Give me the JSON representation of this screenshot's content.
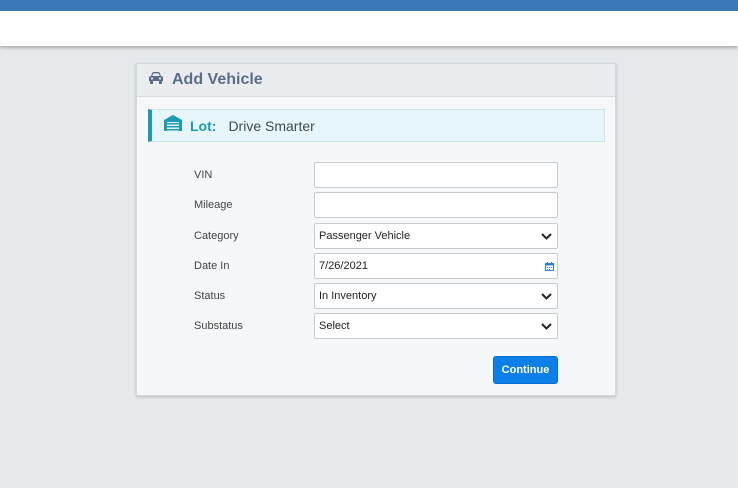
{
  "card": {
    "title": "Add Vehicle",
    "icon": "car-icon"
  },
  "lot": {
    "icon": "warehouse-icon",
    "label": "Lot:",
    "value": "Drive Smarter"
  },
  "form": {
    "vin_label": "VIN",
    "vin_value": "",
    "mileage_label": "Mileage",
    "mileage_value": "",
    "category_label": "Category",
    "category_value": "Passenger Vehicle",
    "date_in_label": "Date In",
    "date_in_value": "7/26/2021",
    "status_label": "Status",
    "status_value": "In Inventory",
    "substatus_label": "Substatus",
    "substatus_value": "Select"
  },
  "actions": {
    "continue_label": "Continue"
  },
  "colors": {
    "topbar": "#3a78b8",
    "accent": "#1b9cb3",
    "button": "#0d7fe8"
  }
}
